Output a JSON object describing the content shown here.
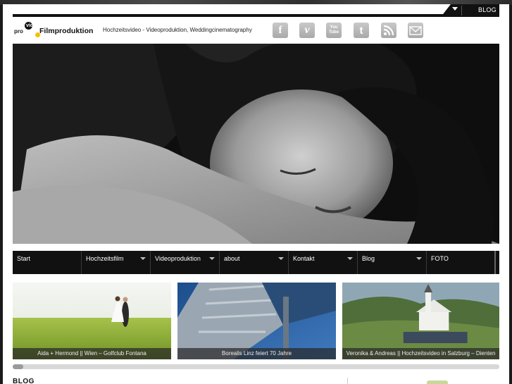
{
  "header": {
    "logo_pro": "pro",
    "logo_vid": "vid",
    "logo_text": "Filmproduktion",
    "tagline": "Hochzeitsvideo - Videoproduktion, Weddingcinematography",
    "topbar_link": "BLOG"
  },
  "social": [
    {
      "icon": "facebook-icon",
      "glyph": "f"
    },
    {
      "icon": "vimeo-icon",
      "glyph": "v"
    },
    {
      "icon": "youtube-icon",
      "glyph": "You Tube"
    },
    {
      "icon": "twitter-icon",
      "glyph": "t"
    },
    {
      "icon": "rss-icon",
      "glyph": ""
    },
    {
      "icon": "mail-icon",
      "glyph": ""
    }
  ],
  "nav": {
    "items": [
      {
        "label": "Start",
        "dropdown": false
      },
      {
        "label": "Hochzeitsfilm",
        "dropdown": true
      },
      {
        "label": "Videoproduktion",
        "dropdown": true
      },
      {
        "label": "about",
        "dropdown": true
      },
      {
        "label": "Kontakt",
        "dropdown": true
      },
      {
        "label": "Blog",
        "dropdown": true
      },
      {
        "label": "FOTO",
        "dropdown": false
      }
    ]
  },
  "slider": {
    "items": [
      {
        "caption": "Aida + Hermond || Wien – Golfclub Fontana"
      },
      {
        "caption": "Borealis Linz feiert 70 Jahre"
      },
      {
        "caption": "Veronika & Andreas || Hochzeitsvideo in Salzburg – Dienten"
      }
    ]
  },
  "section": {
    "blog_heading": "BLOG"
  },
  "colors": {
    "nav_bg": "#111111",
    "logo_accent": "#f2c200",
    "icon_gray": "#b4b4b4"
  }
}
